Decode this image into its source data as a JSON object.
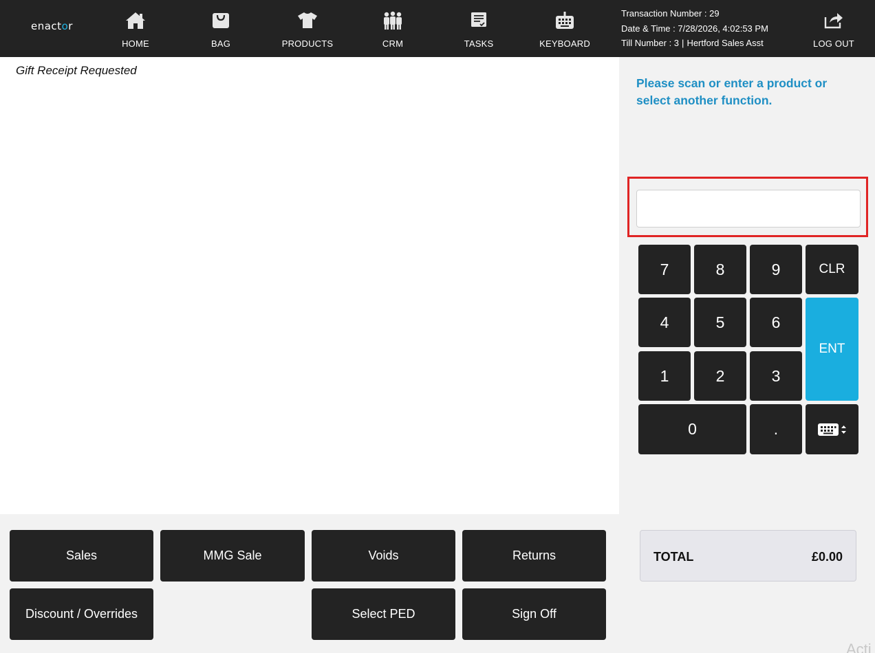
{
  "header": {
    "logo_main": "enact",
    "logo_accent": "o",
    "logo_end": "r",
    "nav": [
      {
        "label": "HOME",
        "icon": "home-icon"
      },
      {
        "label": "BAG",
        "icon": "bag-icon"
      },
      {
        "label": "PRODUCTS",
        "icon": "tshirt-icon"
      },
      {
        "label": "CRM",
        "icon": "people-icon"
      },
      {
        "label": "TASKS",
        "icon": "tasks-icon"
      },
      {
        "label": "KEYBOARD",
        "icon": "keyboard-icon"
      }
    ],
    "transaction_number": "Transaction Number : 29",
    "date_time": "Date & Time : 7/28/2026, 4:02:53 PM",
    "till_number": "Till Number : 3",
    "separator": "|",
    "operator": "Hertford Sales Asst",
    "logout_label": "LOG OUT"
  },
  "receipt": {
    "gift_receipt_text": "Gift Receipt Requested"
  },
  "prompt": {
    "message": "Please scan or enter a product or select another function."
  },
  "scan_input": {
    "value": "",
    "placeholder": ""
  },
  "keypad": {
    "k7": "7",
    "k8": "8",
    "k9": "9",
    "clr": "CLR",
    "k4": "4",
    "k5": "5",
    "k6": "6",
    "ent": "ENT",
    "k1": "1",
    "k2": "2",
    "k3": "3",
    "k0": "0",
    "dot": "."
  },
  "total": {
    "label": "TOTAL",
    "value": "£0.00"
  },
  "functions": {
    "sales": "Sales",
    "mmg_sale": "MMG Sale",
    "voids": "Voids",
    "returns": "Returns",
    "discount": "Discount / Overrides",
    "select_ped": "Select PED",
    "sign_off": "Sign Off"
  },
  "colors": {
    "header_bg": "#232323",
    "accent_blue": "#1aaedf",
    "prompt_blue": "#1f8fc4",
    "highlight_red": "#e02424"
  },
  "watermark": "Acti"
}
